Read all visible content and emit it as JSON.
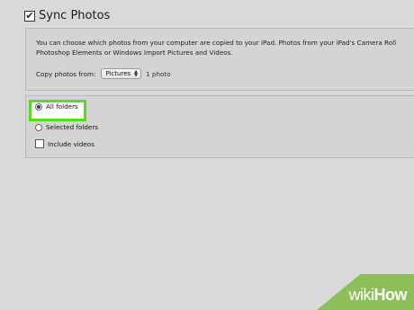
{
  "sync": {
    "title": "Sync Photos",
    "checked": true,
    "description_line1": "You can choose which photos from your computer are copied to your iPad. Photos from your iPad's Camera Roll",
    "description_line2": "Photoshop Elements or Windows Import Pictures and Videos.",
    "copy_label": "Copy photos from:",
    "source_select": {
      "value": "Pictures",
      "icon": "updown-arrows-icon"
    },
    "photo_count": "1 photo"
  },
  "options": {
    "all_folders": {
      "label": "All folders",
      "selected": true
    },
    "selected_folders": {
      "label": "Selected folders",
      "selected": false
    },
    "include_videos": {
      "label": "Include videos",
      "checked": false
    }
  },
  "watermark": {
    "prefix": "wiki",
    "suffix": "How"
  },
  "colors": {
    "highlight": "#55dd22",
    "watermark_bg": "#8cbf5a",
    "background": "#d9d9d9"
  }
}
